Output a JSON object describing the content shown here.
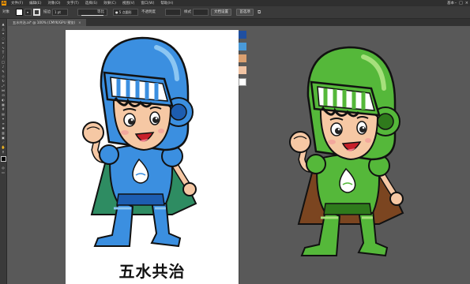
{
  "menubar": {
    "logo": "Ai",
    "items": [
      "文件(F)",
      "编辑(E)",
      "对象(O)",
      "文字(T)",
      "选择(S)",
      "效果(C)",
      "视图(V)",
      "窗口(W)",
      "帮助(H)"
    ],
    "right_label": "基本",
    "win_controls": [
      "–",
      "□",
      "×"
    ]
  },
  "controlbar": {
    "selection_label": "对象",
    "stroke_label": "描边",
    "stroke_value": "1 pt",
    "profile_label": "等比",
    "brush_value": "● 5 点圆形",
    "opacity_label": "不透明度",
    "style_label": "样式",
    "doc_setup_button": "文档设置",
    "prefs_button": "首选项"
  },
  "tab": {
    "title": "五水共治.ai* @ 100% (CMYK/GPU 预览)",
    "close": "×"
  },
  "artwork": {
    "caption": "五水共治"
  },
  "swatches": {
    "colors": [
      "#1f4fa0",
      "#4a9ad8",
      "#dba070",
      "#f1c4a4",
      "#ffffff"
    ]
  },
  "mascots": [
    {
      "name": "blue",
      "main": "#3b8fe0",
      "dark": "#1d5db0",
      "light": "#8cc6f2",
      "cape": "#2e8c62"
    },
    {
      "name": "green",
      "main": "#55b83a",
      "dark": "#2f7a1c",
      "light": "#a6e07c",
      "cape": "#7b4520"
    }
  ]
}
